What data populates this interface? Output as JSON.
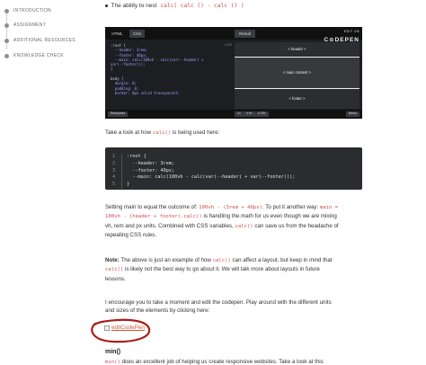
{
  "sidebar": {
    "items": [
      {
        "label": "INTRODUCTION",
        "active": false
      },
      {
        "label": "ASSIGNMENT",
        "active": false
      },
      {
        "label": "ADDITIONAL RESOURCES",
        "active": false
      },
      {
        "label": "KNOWLEDGE CHECK",
        "active": false
      }
    ]
  },
  "bullet": {
    "text": "The ability to nest",
    "code": "calc( calc () - calc () )"
  },
  "codepen": {
    "tabs": {
      "html": "HTML",
      "css": "CSS",
      "result": "Result"
    },
    "logo_small": "EDIT ON",
    "logo_big": "C⊙DEPEN",
    "lang_label": "LIVE",
    "code_lines": [
      ":root {",
      "  --header: 3rem;",
      "  --footer: 40px;",
      "  --main: calc(100vh - calc(var(--header) +",
      "var(--footer)));",
      "}",
      "",
      "body {",
      "  margin: 0;",
      "  padding: 0;",
      "  border: 0px solid transparent;"
    ],
    "result": {
      "header": "< header >",
      "main": "< main content >",
      "footer": "< footer >"
    },
    "bottom": {
      "resources": "Resources",
      "zoom_1x": "1×",
      "zoom_05x": "0.5×",
      "zoom_025x": "0.25×",
      "rerun": "Rerun"
    }
  },
  "para1": {
    "before": "Take a look at how",
    "code": "calc()",
    "after": "is being used here:"
  },
  "codeblock": {
    "lines": [
      {
        "num": "1",
        "text": ":root {"
      },
      {
        "num": "2",
        "text": "  --header: 3rem;"
      },
      {
        "num": "3",
        "text": "  --footer: 40px;"
      },
      {
        "num": "4",
        "text": "  --main: calc(100vh - calc(var(--header) + var(--footer)));"
      },
      {
        "num": "5",
        "text": "}"
      }
    ]
  },
  "para2": {
    "t1": "Setting main to equal the outcome of:",
    "c1": "100vh - (3rem + 40px)",
    "t2": ". To put it another way:",
    "c2": "main = 100vh - (header + footer).calc()",
    "t3": "is handling the math for us even though we are mixing vh, rem and px units. Combined with CSS variables,",
    "c3": "calc()",
    "t4": "can save us from the headache of repeating CSS rules."
  },
  "para3": {
    "bold": "Note:",
    "t1": "The above is just an example of how",
    "c1": "calc()",
    "t2": "can affect a layout, but keep in mind that",
    "c2": "calc()",
    "t3": "is likely not the best way to go about it. We will talk more about layouts in future lessons."
  },
  "para4": {
    "text": "I encourage you to take a moment and edit the codepen. Play around with the different units and sizes of the elements by clicking here:"
  },
  "image_link": {
    "alt": "editCodePen"
  },
  "section": {
    "heading": "min()",
    "partial_code": "min()",
    "partial_text": "does an excellent job of helping us create responsive websites. Take a look at this"
  },
  "colors": {
    "code_red": "#d14b4b",
    "annotation_red": "#a8201a",
    "link": "#cc5a35"
  }
}
